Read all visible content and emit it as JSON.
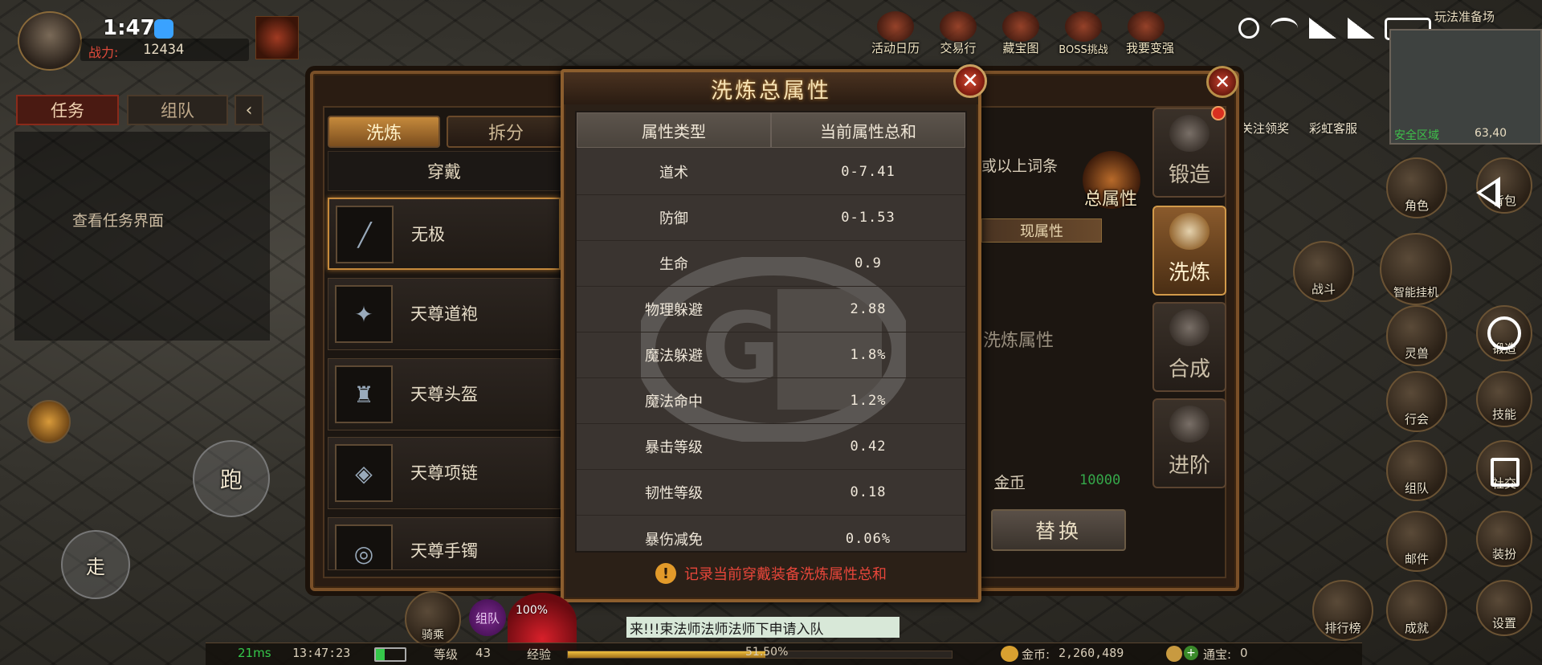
{
  "status_bar": {
    "time": "1:47"
  },
  "player": {
    "power_label": "战力:",
    "power_value": "12434"
  },
  "top_icons": [
    "活动日历",
    "交易行",
    "藏宝图",
    "BOSS挑战",
    "我要变强"
  ],
  "second_row_icons": [
    "关注领奖",
    "彩虹客服"
  ],
  "minimap": {
    "title": "玩法准备场",
    "zone": "安全区域",
    "coords": "63,40"
  },
  "left_panel": {
    "tab_task": "任务",
    "tab_team": "组队",
    "task_hint": "查看任务界面"
  },
  "left_controls": {
    "run": "跑",
    "walk": "走"
  },
  "main_panel": {
    "tabs": [
      "洗炼",
      "拆分"
    ],
    "dropdown": "穿戴",
    "equipment": [
      {
        "name": "无极",
        "selected": true
      },
      {
        "name": "天尊道袍",
        "selected": false
      },
      {
        "name": "天尊头盔",
        "selected": false
      },
      {
        "name": "天尊项链",
        "selected": false
      },
      {
        "name": "天尊手镯",
        "selected": false
      }
    ],
    "right_text_1": "或以上词条",
    "total_attr_label": "总属性",
    "current_attr_label": "现属性",
    "refine_attr_label": "洗炼属性",
    "gold_label": "金币",
    "gold_value": "10000",
    "replace_button": "替换",
    "side_buttons": [
      "锻造",
      "洗炼",
      "合成",
      "进阶"
    ]
  },
  "modal": {
    "title": "洗炼总属性",
    "col_type": "属性类型",
    "col_total": "当前属性总和",
    "rows": [
      {
        "type": "道术",
        "value": "0-7.41"
      },
      {
        "type": "防御",
        "value": "0-1.53"
      },
      {
        "type": "生命",
        "value": "0.9"
      },
      {
        "type": "物理躲避",
        "value": "2.88"
      },
      {
        "type": "魔法躲避",
        "value": "1.8%"
      },
      {
        "type": "魔法命中",
        "value": "1.2%"
      },
      {
        "type": "暴击等级",
        "value": "0.42"
      },
      {
        "type": "韧性等级",
        "value": "0.18"
      },
      {
        "type": "暴伤减免",
        "value": "0.06%"
      }
    ],
    "note": "记录当前穿戴装备洗炼属性总和"
  },
  "right_menu": [
    {
      "label": "角色"
    },
    {
      "label": "背包"
    },
    {
      "label": "战斗"
    },
    {
      "label": "智能挂机"
    },
    {
      "label": "灵兽"
    },
    {
      "label": "锻造"
    },
    {
      "label": "行会"
    },
    {
      "label": "技能"
    },
    {
      "label": "组队"
    },
    {
      "label": "社交"
    },
    {
      "label": "邮件"
    },
    {
      "label": "装扮"
    },
    {
      "label": "排行榜"
    },
    {
      "label": "成就"
    },
    {
      "label": "设置"
    }
  ],
  "bottom_bar": {
    "ping": "21ms",
    "clock": "13:47:23",
    "level_label": "等级",
    "level_value": "43",
    "exp_label": "经验",
    "exp_value": "51.50%",
    "exp_fraction": 0.515,
    "gold_label": "金币:",
    "gold_value": "2,260,489",
    "tongbao_label": "通宝:",
    "tongbao_value": "0"
  },
  "chat": {
    "message": "来!!!束法师法师法师下申请入队"
  },
  "bottom_center": {
    "team": "组队",
    "mount": "骑乘",
    "hp_pct": "100%"
  },
  "colors": {
    "accent": "#c58a3c",
    "warning": "#e8463a",
    "gold_green": "#35a84a"
  }
}
